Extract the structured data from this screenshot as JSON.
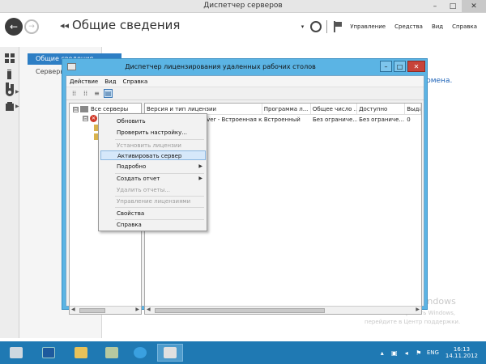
{
  "server_manager": {
    "title": "Диспетчер серверов",
    "page_title": "Общие сведения",
    "breadcrumb_arrows": "◂◂",
    "menu": [
      "Управление",
      "Средства",
      "Вид",
      "Справка"
    ],
    "nav_selected": "Общие сведения",
    "nav_item": "Серверы",
    "main_link_fragment": "домена."
  },
  "license_manager": {
    "title": "Диспетчер лицензирования удаленных рабочих столов",
    "menubar": [
      "Действие",
      "Вид",
      "Справка"
    ],
    "tree": {
      "root": "Все серверы",
      "child_box": "⊟"
    },
    "columns": [
      "Версия и тип лицензии",
      "Программа л...",
      "Общее число ...",
      "Доступно",
      "Выдан"
    ],
    "rows": [
      [
        "Windows 2012 Server - Встроенная кли...",
        "Встроенный",
        "Без ограниче...",
        "Без ограниче...",
        "0"
      ]
    ]
  },
  "context_menu": {
    "items": [
      {
        "label": "Обновить",
        "disabled": false
      },
      {
        "label": "Проверить настройку...",
        "disabled": false
      },
      {
        "label": "Установить лицензии",
        "disabled": true
      },
      {
        "label": "Активировать сервер",
        "disabled": false,
        "highlighted": true
      },
      {
        "label": "Подробно",
        "disabled": false,
        "submenu": true
      },
      {
        "label": "Создать отчет",
        "disabled": false,
        "submenu": true
      },
      {
        "label": "Удалить отчеты...",
        "disabled": true
      },
      {
        "label": "Управление лицензиями",
        "disabled": true
      },
      {
        "label": "Свойства",
        "disabled": false
      },
      {
        "label": "Справка",
        "disabled": false
      }
    ]
  },
  "activation": {
    "title": "Активация Windows",
    "line1": "Чтобы активировать Windows,",
    "line2": "перейдите в Центр поддержки."
  },
  "taskbar": {
    "lang": "ENG",
    "time": "16:13",
    "date": "14.11.2012"
  },
  "colors": {
    "accent": "#2d7ec4",
    "dialog_frame": "#5bb4e4",
    "taskbar": "#1f79b3"
  }
}
